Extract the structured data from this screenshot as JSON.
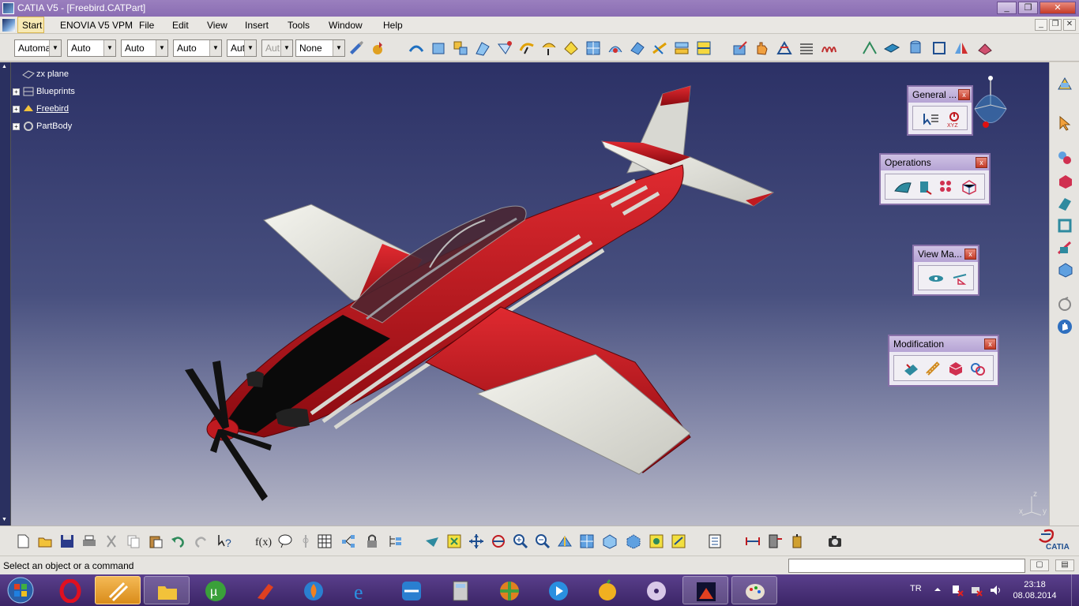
{
  "window": {
    "title": "CATIA V5 - [Freebird.CATPart]",
    "minimize": "_",
    "restore": "❐",
    "close": "✕"
  },
  "menu": {
    "items": [
      "Start",
      "ENOVIA V5 VPM",
      "File",
      "Edit",
      "View",
      "Insert",
      "Tools",
      "Window",
      "Help"
    ]
  },
  "toolbar_combos": [
    {
      "value": "Automa",
      "disabled": false
    },
    {
      "value": "Auto",
      "disabled": false
    },
    {
      "value": "Auto",
      "disabled": false
    },
    {
      "value": "Auto",
      "disabled": false
    },
    {
      "value": "Aut",
      "disabled": false
    },
    {
      "value": "Aut",
      "disabled": true
    },
    {
      "value": "None",
      "disabled": false
    }
  ],
  "tree": [
    {
      "label": "zx plane",
      "icon": "plane-icon"
    },
    {
      "label": "Blueprints",
      "icon": "blueprint-icon"
    },
    {
      "label": "Freebird",
      "icon": "part-icon"
    },
    {
      "label": "PartBody",
      "icon": "gear-icon"
    }
  ],
  "palettes": {
    "general": {
      "title": "General ...",
      "close": "x"
    },
    "operations": {
      "title": "Operations",
      "close": "x"
    },
    "view_manip": {
      "title": "View Ma...",
      "close": "x"
    },
    "modification": {
      "title": "Modification",
      "close": "x"
    }
  },
  "axis": {
    "x": "x",
    "y": "y",
    "z": "z"
  },
  "status": {
    "text": "Select an object or a command"
  },
  "brand": {
    "bottom_logo": "CATIA"
  },
  "taskbar": {
    "language": "TR",
    "time": "23:18",
    "date": "08.08.2014"
  },
  "colors": {
    "title_bar": "#8a6db3",
    "viewport_top": "#2c3166",
    "plane_red": "#b3121b",
    "plane_white": "#e8e8e2"
  }
}
